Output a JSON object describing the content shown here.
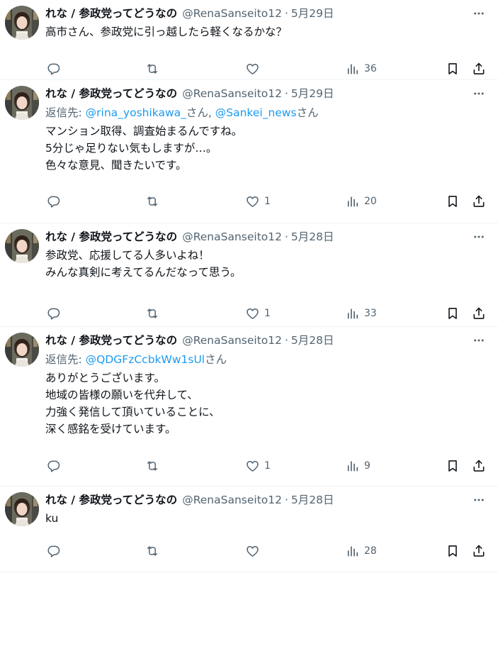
{
  "tweets": [
    {
      "name": "れな / 参政党ってどうなの",
      "handle": "@RenaSanseito12",
      "date": "5月29日",
      "reply_prefix": "",
      "reply_users": [],
      "text": "高市さん、参政党に引っ越したら軽くなるかな？",
      "likes": "",
      "views": "36"
    },
    {
      "name": "れな / 参政党ってどうなの",
      "handle": "@RenaSanseito12",
      "date": "5月29日",
      "reply_prefix": "返信先: ",
      "reply_users": [
        {
          "user": "@rina_yoshikawa_",
          "suffix": "さん, "
        },
        {
          "user": "@Sankei_news",
          "suffix": "さん"
        }
      ],
      "text": "マンション取得、調査始まるんですね。\n5分じゃ足りない気もしますが…。\n色々な意見、聞きたいです。",
      "likes": "1",
      "views": "20"
    },
    {
      "name": "れな / 参政党ってどうなの",
      "handle": "@RenaSanseito12",
      "date": "5月28日",
      "reply_prefix": "",
      "reply_users": [],
      "text": "参政党、応援してる人多いよね！\nみんな真剣に考えてるんだなって思う。",
      "likes": "1",
      "views": "33"
    },
    {
      "name": "れな / 参政党ってどうなの",
      "handle": "@RenaSanseito12",
      "date": "5月28日",
      "reply_prefix": "返信先: ",
      "reply_users": [
        {
          "user": "@QDGFzCcbkWw1sUl",
          "suffix": "さん"
        }
      ],
      "text": "ありがとうございます。\n地域の皆様の願いを代弁して、\n力強く発信して頂いていることに、\n深く感銘を受けています。",
      "likes": "1",
      "views": "9"
    },
    {
      "name": "れな / 参政党ってどうなの",
      "handle": "@RenaSanseito12",
      "date": "5月28日",
      "reply_prefix": "",
      "reply_users": [],
      "text": "ku",
      "likes": "",
      "views": "28"
    }
  ],
  "colors": {
    "text": "#0f1419",
    "secondary": "#536471",
    "link": "#1d9bf0",
    "divider": "#eff3f4"
  },
  "icons": [
    "reply-icon",
    "retweet-icon",
    "like-icon",
    "views-icon",
    "bookmark-icon",
    "share-icon",
    "more-icon"
  ]
}
